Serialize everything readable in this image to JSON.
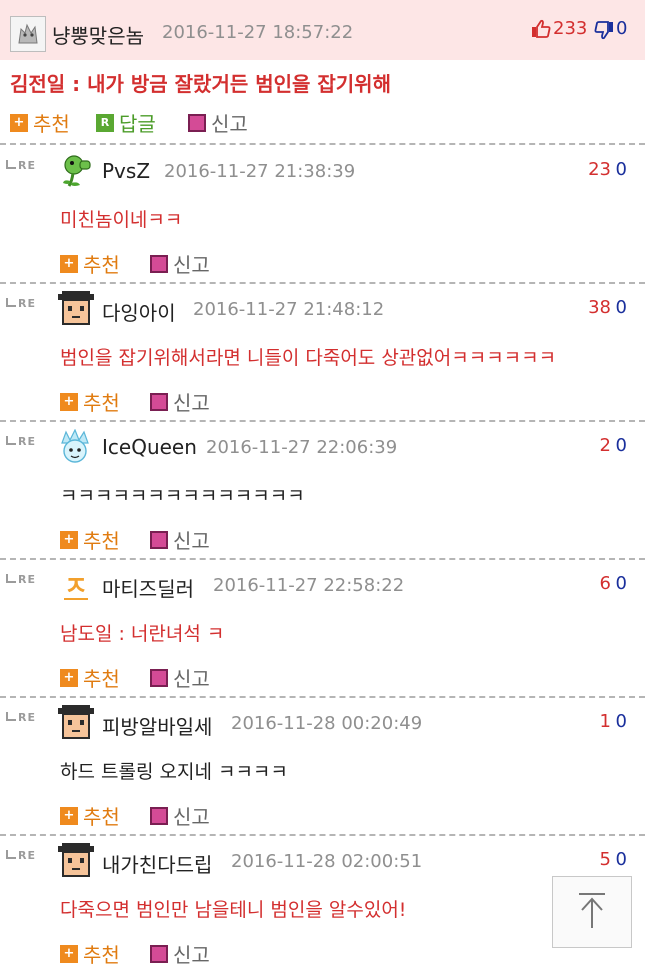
{
  "post": {
    "nickname": "냥뿡맞은놈",
    "datetime": "2016-11-27 18:57:22",
    "upvotes": "233",
    "downvotes": "0",
    "title": "김전일 : 내가 방금 잘랐거든 범인을 잡기위해",
    "actions": {
      "recommend": "추천",
      "reply": "답글",
      "report": "신고"
    }
  },
  "reply_icon_text": "RE",
  "replies": [
    {
      "nickname": "PvsZ",
      "datetime": "2016-11-27 21:38:39",
      "up": "23",
      "down": "0",
      "body": "미친놈이네ㅋㅋ",
      "body_color": "red",
      "avatar": "peashooter-avatar"
    },
    {
      "nickname": "다잉아이",
      "datetime": "2016-11-27 21:48:12",
      "up": "38",
      "down": "0",
      "body": "범인을 잡기위해서라면 니들이 다죽어도 상관없어ㅋㅋㅋㅋㅋㅋ",
      "body_color": "red",
      "avatar": "pixel-face-avatar"
    },
    {
      "nickname": "IceQueen",
      "datetime": "2016-11-27 22:06:39",
      "up": "2",
      "down": "0",
      "body": "ㅋㅋㅋㅋㅋㅋㅋㅋㅋㅋㅋㅋㅋㅋ",
      "body_color": "black",
      "avatar": "ice-queen-avatar"
    },
    {
      "nickname": "마티즈딜러",
      "datetime": "2016-11-27 22:58:22",
      "up": "6",
      "down": "0",
      "body": "남도일 : 너란녀석 ㅋ",
      "body_color": "red",
      "avatar": "letter-avatar"
    },
    {
      "nickname": "피방알바일세",
      "datetime": "2016-11-28 00:20:49",
      "up": "1",
      "down": "0",
      "body": "하드 트롤링 오지네 ㅋㅋㅋㅋ",
      "body_color": "black",
      "avatar": "pixel-face-avatar"
    },
    {
      "nickname": "내가친다드립",
      "datetime": "2016-11-28 02:00:51",
      "up": "5",
      "down": "0",
      "body": "다죽으면 범인만 남을테니 범인을 알수있어!",
      "body_color": "red",
      "avatar": "pixel-face-avatar"
    }
  ],
  "reply_actions": {
    "recommend": "추천",
    "report": "신고"
  },
  "colors": {
    "accent_red": "#d32f2f",
    "downvote_blue": "#1a2f9c",
    "header_bg": "#fde6e6",
    "recommend_orange": "#ef8a1e"
  },
  "scroll_top_icon": "arrow-up-icon"
}
